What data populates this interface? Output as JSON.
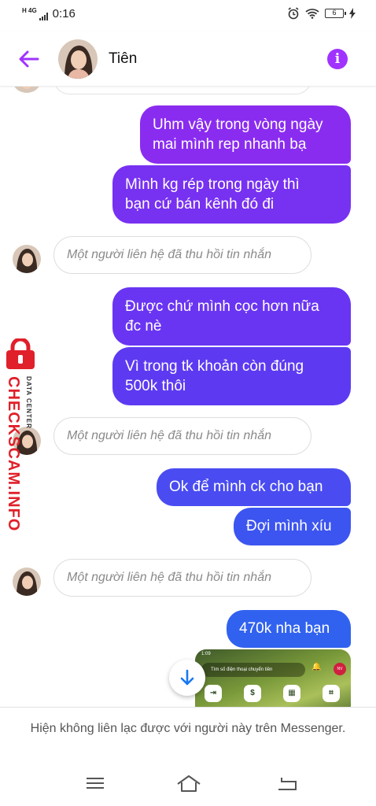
{
  "status_bar": {
    "network_label": "H 4G",
    "time": "0:16",
    "battery": "6"
  },
  "header": {
    "contact_name": "Tiên",
    "info_icon_glyph": "i"
  },
  "messages": [
    {
      "type": "outgoing",
      "text_line1": "Uhm vậy trong vòng ngày",
      "text_line2": "mai mình rep nhanh bạ"
    },
    {
      "type": "outgoing",
      "text_line1": "Mình kg rép trong ngày thì",
      "text_line2": "bạn cứ bán kênh đó đi"
    },
    {
      "type": "removed",
      "text": "Một người liên hệ đã thu hồi tin nhắn"
    },
    {
      "type": "outgoing",
      "text_line1": "Được chứ mình cọc hơn nữa",
      "text_line2": "đc nè"
    },
    {
      "type": "outgoing",
      "text_line1": "Vì trong tk khoản còn đúng",
      "text_line2": "500k thôi"
    },
    {
      "type": "removed",
      "text": "Một người liên hệ đã thu hồi tin nhắn"
    },
    {
      "type": "outgoing",
      "text_line1": "Ok để mình ck cho bạn"
    },
    {
      "type": "outgoing",
      "text_line1": "Đợi mình xíu"
    },
    {
      "type": "removed",
      "text": "Một người liên hệ đã thu hồi tin nhắn"
    },
    {
      "type": "outgoing",
      "text_line1": "470k nha bạn"
    }
  ],
  "attachment": {
    "status_time": "1:09",
    "search_placeholder": "Tìm số điện thoại chuyển tiền",
    "avatar_initials": "NV"
  },
  "watermark": {
    "main": "CHECKSCAM.INFO",
    "sub": "DATA CENTER"
  },
  "footer": {
    "text": "Hiện không liên lạc được với người này trên Messenger."
  },
  "colors": {
    "accent": "#a033ff",
    "bubble_purple": "#8a2cf0",
    "bubble_violet": "#6a35f2",
    "bubble_blue": "#3c55f0",
    "watermark_red": "#e0202a"
  }
}
